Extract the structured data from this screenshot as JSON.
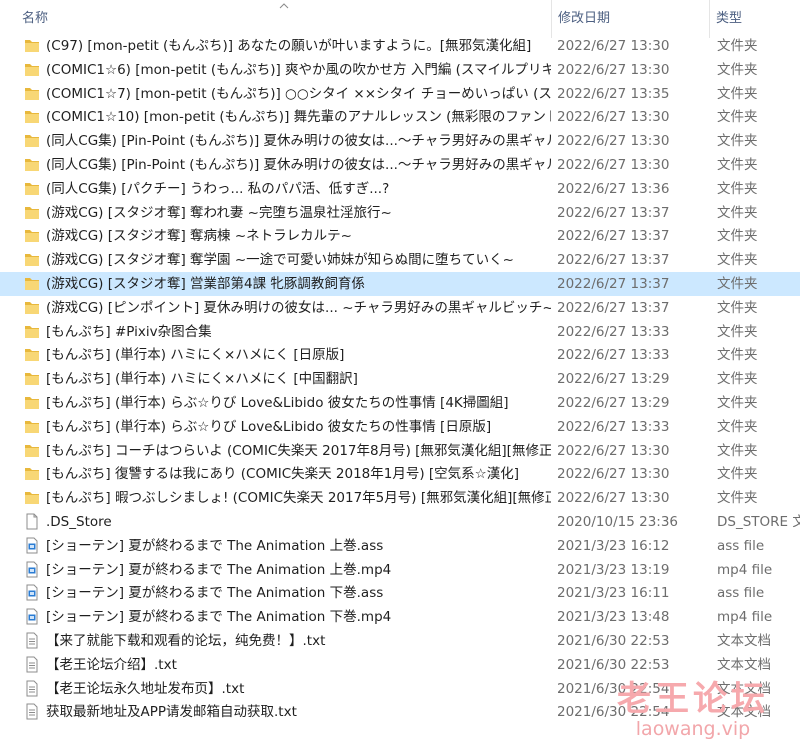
{
  "columns": {
    "name": "名称",
    "date": "修改日期",
    "type": "类型"
  },
  "colors": {
    "selected_row": "#cce8ff",
    "folder": "#f8d775",
    "media_icon": "#2b7cd3",
    "watermark": "#f6a9ad"
  },
  "rows": [
    {
      "icon": "folder-icon",
      "name": "(C97) [mon-petit (もんぷち)] あなたの願いが叶いますように。[無邪気漢化組]",
      "date": "2022/6/27 13:30",
      "type": "文件夹"
    },
    {
      "icon": "folder-icon",
      "name": "(COMIC1☆6) [mon-petit (もんぷち)] 爽やか風の吹かせ方 入門編 (スマイルプリキュア!)",
      "date": "2022/6/27 13:30",
      "type": "文件夹"
    },
    {
      "icon": "folder-icon",
      "name": "(COMIC1☆7) [mon-petit (もんぷち)] ○○シタイ ××シタイ チョーめいっぱい (スマイルプリキュア!)",
      "date": "2022/6/27 13:35",
      "type": "文件夹"
    },
    {
      "icon": "folder-icon",
      "name": "(COMIC1☆10) [mon-petit (もんぷち)] 舞先輩のアナルレッスン (無彩限のファントム・ワールド)",
      "date": "2022/6/27 13:30",
      "type": "文件夹"
    },
    {
      "icon": "folder-icon",
      "name": "(同人CG集) [Pin-Point (もんぷち)] 夏休み明けの彼女は...～チャラ男好みの黒ギャルビッチ～",
      "date": "2022/6/27 13:30",
      "type": "文件夹"
    },
    {
      "icon": "folder-icon",
      "name": "(同人CG集) [Pin-Point (もんぷち)] 夏休み明けの彼女は...～チャラ男好みの黒ギャルビッチ～",
      "date": "2022/6/27 13:30",
      "type": "文件夹"
    },
    {
      "icon": "folder-icon",
      "name": "(同人CG集) [パクチー] うわっ... 私のパパ活、低すぎ...?",
      "date": "2022/6/27 13:36",
      "type": "文件夹"
    },
    {
      "icon": "folder-icon",
      "name": "(游戏CG) [スタジオ奪] 奪われ妻 ~完堕ち温泉社淫旅行~",
      "date": "2022/6/27 13:37",
      "type": "文件夹"
    },
    {
      "icon": "folder-icon",
      "name": "(游戏CG) [スタジオ奪] 奪病棟 ~ネトラレカルテ~",
      "date": "2022/6/27 13:37",
      "type": "文件夹"
    },
    {
      "icon": "folder-icon",
      "name": "(游戏CG) [スタジオ奪] 奪学園 ~一途で可愛い姉妹が知らぬ間に堕ちていく~",
      "date": "2022/6/27 13:37",
      "type": "文件夹"
    },
    {
      "icon": "folder-icon",
      "name": "(游戏CG) [スタジオ奪] 営業部第4課 牝豚調教飼育係",
      "date": "2022/6/27 13:37",
      "type": "文件夹",
      "selected": true
    },
    {
      "icon": "folder-icon",
      "name": "(游戏CG) [ピンポイント] 夏休み明けの彼女は... ~チャラ男好みの黒ギャルビッチ~",
      "date": "2022/6/27 13:37",
      "type": "文件夹"
    },
    {
      "icon": "folder-icon",
      "name": "[もんぷち] #Pixiv杂图合集",
      "date": "2022/6/27 13:33",
      "type": "文件夹"
    },
    {
      "icon": "folder-icon",
      "name": "[もんぷち] (単行本) ハミにく×ハメにく [日原版]",
      "date": "2022/6/27 13:33",
      "type": "文件夹"
    },
    {
      "icon": "folder-icon",
      "name": "[もんぷち] (単行本) ハミにく×ハメにく [中国翻訳]",
      "date": "2022/6/27 13:29",
      "type": "文件夹"
    },
    {
      "icon": "folder-icon",
      "name": "[もんぷち] (単行本) らぶ☆りび Love&Libido 彼女たちの性事情 [4K掃圖組]",
      "date": "2022/6/27 13:29",
      "type": "文件夹"
    },
    {
      "icon": "folder-icon",
      "name": "[もんぷち] (単行本) らぶ☆りび Love&Libido 彼女たちの性事情 [日原版]",
      "date": "2022/6/27 13:33",
      "type": "文件夹"
    },
    {
      "icon": "folder-icon",
      "name": "[もんぷち] コーチはつらいよ (COMIC失楽天 2017年8月号) [無邪気漢化組][無修正]",
      "date": "2022/6/27 13:30",
      "type": "文件夹"
    },
    {
      "icon": "folder-icon",
      "name": "[もんぷち] 復讐するは我にあり (COMIC失楽天 2018年1月号) [空気系☆漢化]",
      "date": "2022/6/27 13:30",
      "type": "文件夹"
    },
    {
      "icon": "folder-icon",
      "name": "[もんぷち] 暇つぶしシましょ! (COMIC失楽天 2017年5月号) [無邪気漢化組][無修正]",
      "date": "2022/6/27 13:30",
      "type": "文件夹"
    },
    {
      "icon": "file-icon",
      "name": ".DS_Store",
      "date": "2020/10/15 23:36",
      "type": "DS_STORE 文件"
    },
    {
      "icon": "media-file-icon",
      "name": "[ショーテン] 夏が終わるまで The Animation 上巻.ass",
      "date": "2021/3/23 16:12",
      "type": "ass file"
    },
    {
      "icon": "media-file-icon",
      "name": "[ショーテン] 夏が終わるまで The Animation 上巻.mp4",
      "date": "2021/3/23 13:19",
      "type": "mp4 file"
    },
    {
      "icon": "media-file-icon",
      "name": "[ショーテン] 夏が終わるまで The Animation 下巻.ass",
      "date": "2021/3/23 16:11",
      "type": "ass file"
    },
    {
      "icon": "media-file-icon",
      "name": "[ショーテン] 夏が終わるまで The Animation 下巻.mp4",
      "date": "2021/3/23 13:48",
      "type": "mp4 file"
    },
    {
      "icon": "text-file-icon",
      "name": "【来了就能下载和观看的论坛，纯免费！】.txt",
      "date": "2021/6/30 22:53",
      "type": "文本文档"
    },
    {
      "icon": "text-file-icon",
      "name": "【老王论坛介绍】.txt",
      "date": "2021/6/30 22:53",
      "type": "文本文档"
    },
    {
      "icon": "text-file-icon",
      "name": "【老王论坛永久地址发布页】.txt",
      "date": "2021/6/30 22:54",
      "type": "文本文档"
    },
    {
      "icon": "text-file-icon",
      "name": "获取最新地址及APP请发邮箱自动获取.txt",
      "date": "2021/6/30 22:54",
      "type": "文本文档"
    }
  ],
  "watermark": {
    "title": "老王论坛",
    "url": "laowang.vip"
  }
}
